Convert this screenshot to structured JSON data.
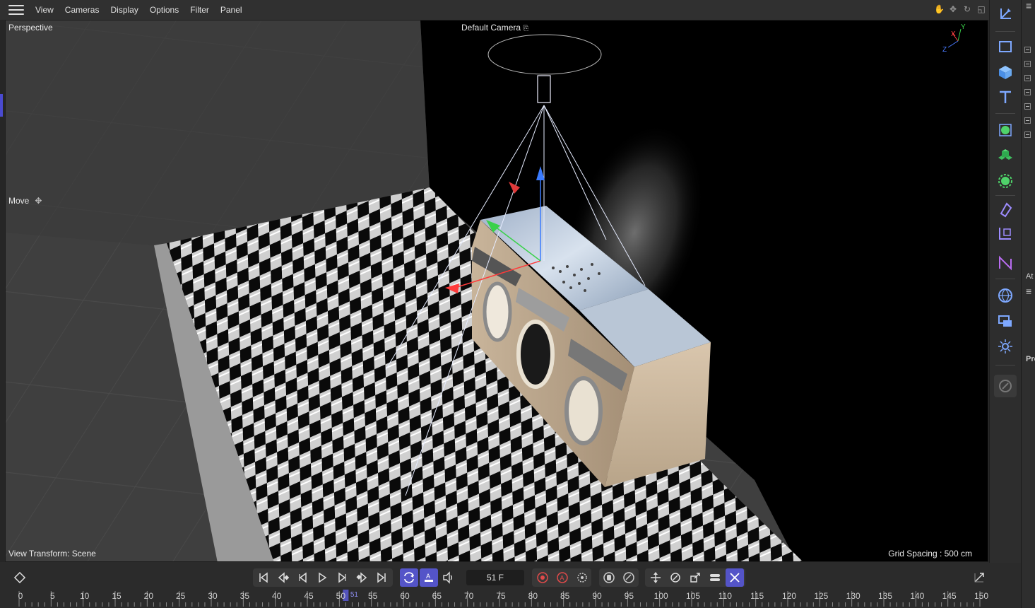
{
  "menubar": {
    "items": [
      "View",
      "Cameras",
      "Display",
      "Options",
      "Filter",
      "Panel"
    ]
  },
  "viewport": {
    "name": "Perspective",
    "camera_label": "Default Camera",
    "tool_label": "Move",
    "view_transform": "View Transform: Scene",
    "grid_spacing": "Grid Spacing : 500 cm",
    "axis_labels": {
      "x": "X",
      "y": "Y",
      "z": "Z"
    }
  },
  "palette": {
    "icons": [
      "coordinate-system-icon",
      "rectangle-select-icon",
      "cube-icon",
      "text-icon",
      "subdivision-icon",
      "cloner-icon",
      "deformer-icon",
      "tag-icon",
      "camera-view-icon",
      "spline-pen-icon",
      "environment-icon",
      "render-region-icon",
      "light-icon",
      "edit-render-icon"
    ],
    "accent": "#5a5ad6"
  },
  "farright": {
    "at_label": "At",
    "pro_label": "Pro"
  },
  "timeline": {
    "current_frame": "51 F",
    "ruler_ticks": [
      "0",
      "5",
      "10",
      "15",
      "20",
      "25",
      "30",
      "35",
      "40",
      "45",
      "50",
      "55",
      "60",
      "65",
      "70",
      "75",
      "80",
      "85",
      "90",
      "95",
      "100",
      "105",
      "110",
      "115",
      "120",
      "125",
      "130",
      "135",
      "140",
      "145",
      "150"
    ],
    "current_tick": "51"
  }
}
